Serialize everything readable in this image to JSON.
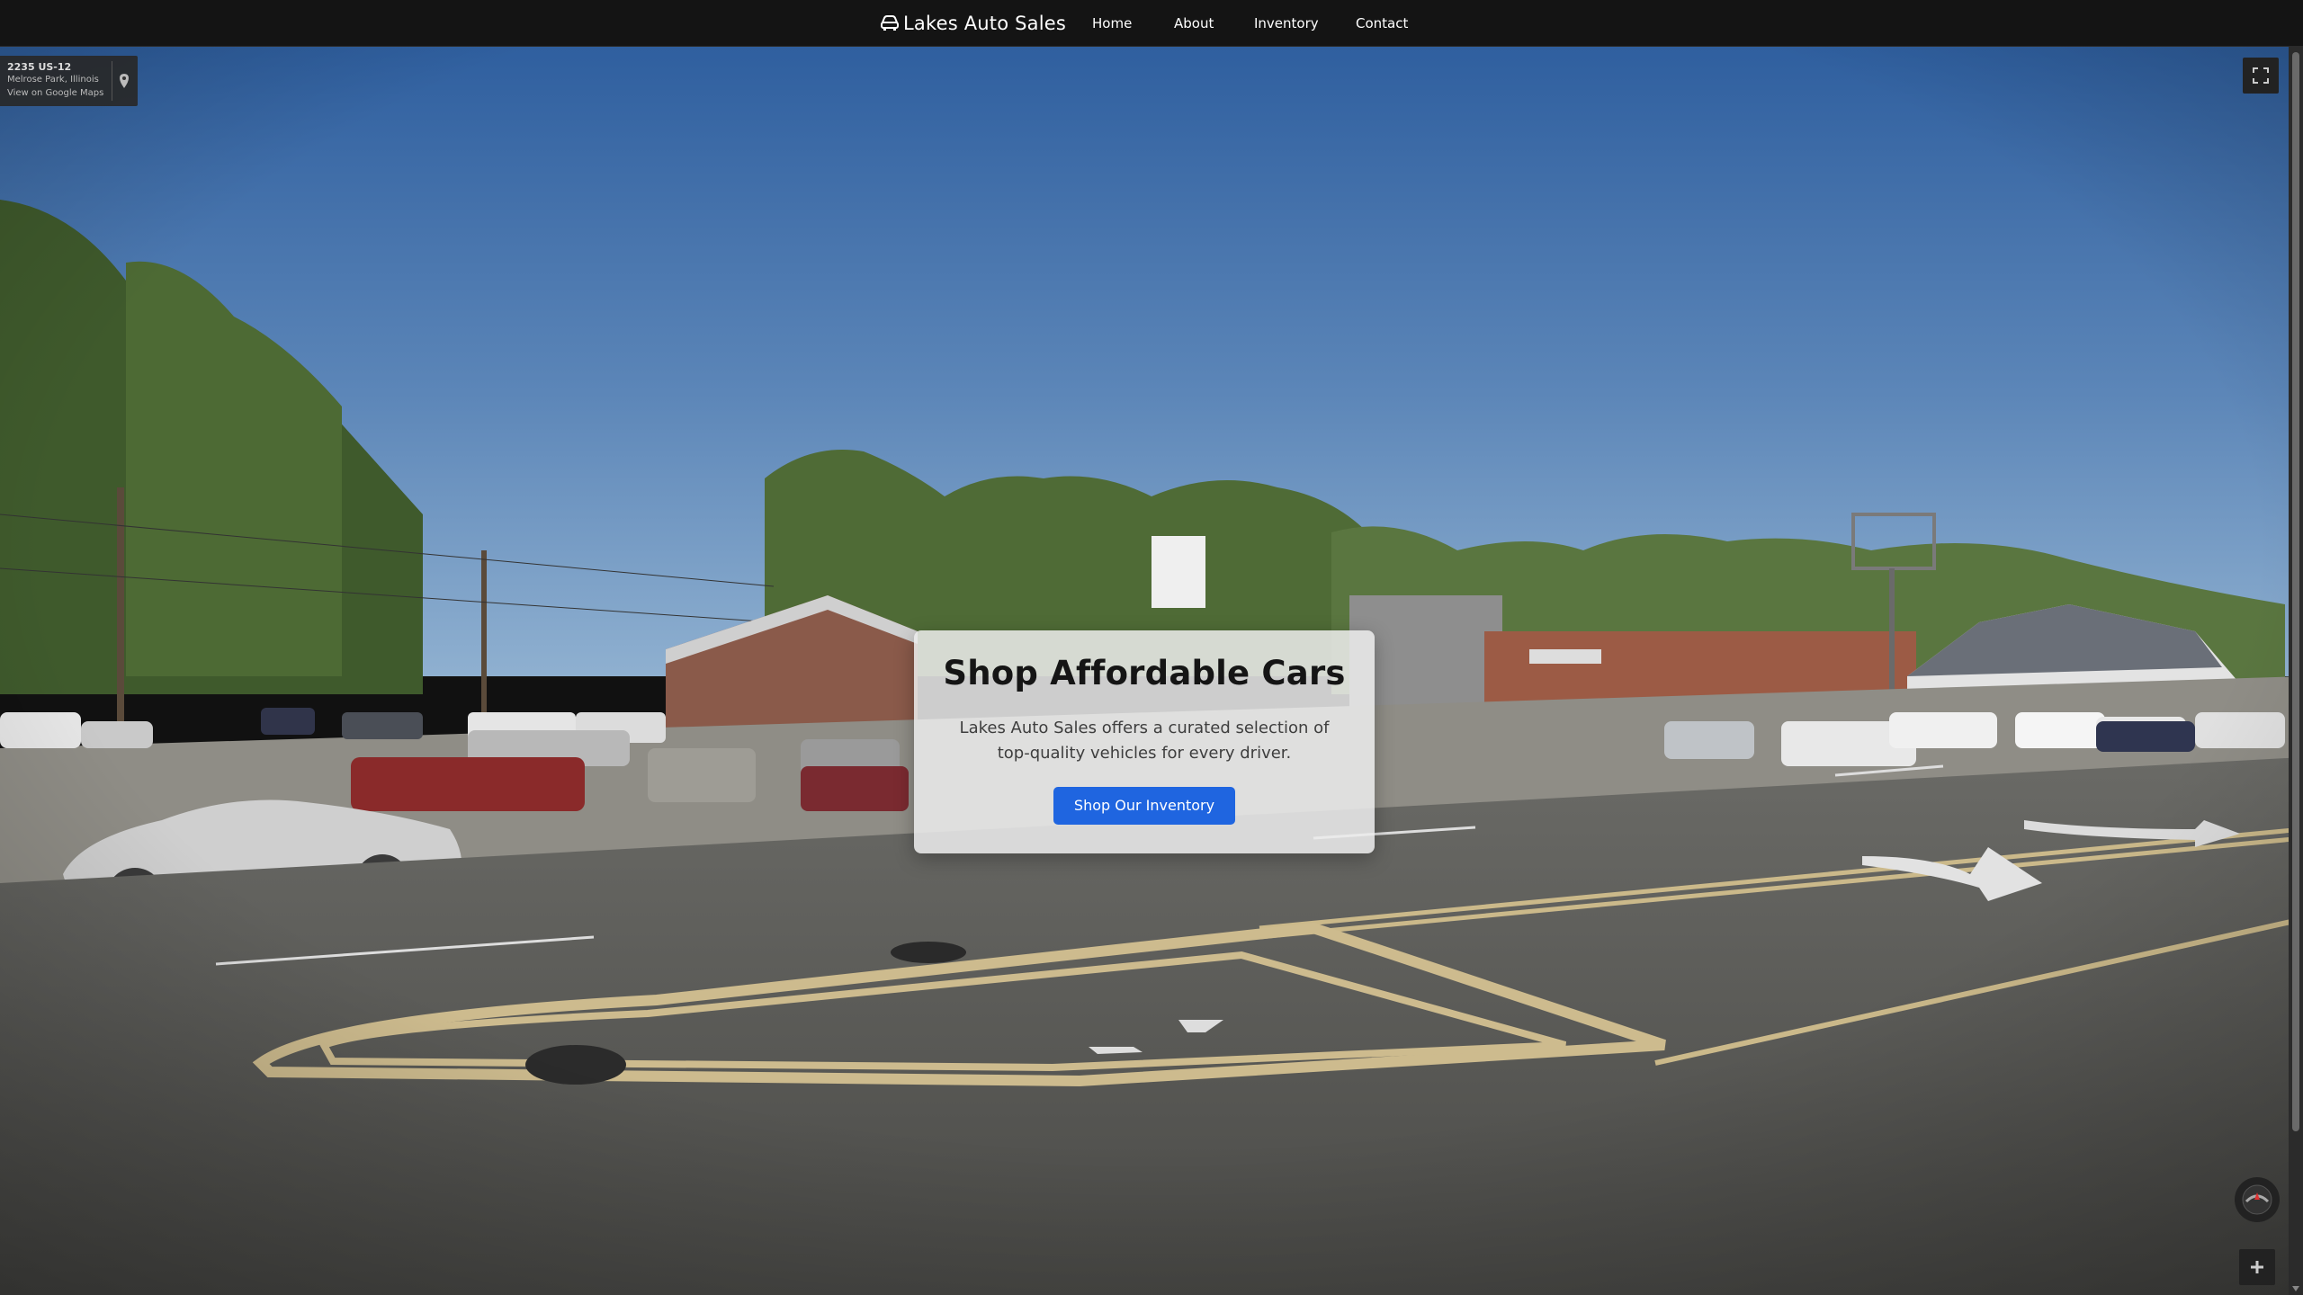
{
  "nav": {
    "brand": "Lakes Auto Sales",
    "brand_icon": "car-icon",
    "links": [
      "Home",
      "About",
      "Inventory",
      "Contact"
    ]
  },
  "map_overlay": {
    "address": "2235 US-12",
    "city": "Melrose Park, Illinois",
    "link": "View on Google Maps",
    "pin_icon": "map-pin-icon",
    "fullscreen_icon": "fullscreen-icon",
    "compass_icon": "compass-icon",
    "zoom_icon": "zoom-in-icon"
  },
  "hero": {
    "title": "Shop Affordable Cars",
    "description": "Lakes Auto Sales offers a curated selection of top-quality vehicles for every driver.",
    "cta": "Shop Our Inventory"
  },
  "colors": {
    "nav_bg": "#141414",
    "cta_bg": "#1f65e0",
    "card_bg": "#ececec"
  }
}
